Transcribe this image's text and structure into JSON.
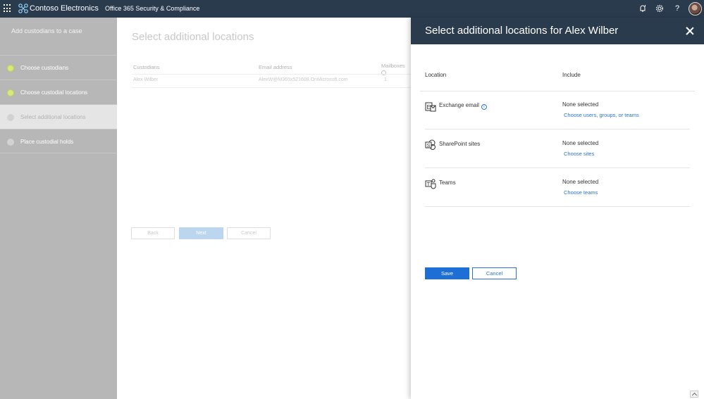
{
  "topbar": {
    "brand": "Contoso Electronics",
    "app": "Office 365 Security & Compliance",
    "icons": [
      "waffle-icon",
      "bell-icon",
      "gear-icon",
      "help-icon",
      "avatar"
    ]
  },
  "leftnav": {
    "title": "Add custodians to a case",
    "steps": [
      {
        "label": "Choose custodians",
        "state": "done"
      },
      {
        "label": "Choose custodial locations",
        "state": "done"
      },
      {
        "label": "Select additional locations",
        "state": "current"
      },
      {
        "label": "Place custodial holds",
        "state": "pending"
      }
    ]
  },
  "main": {
    "title": "Select additional locations",
    "columns": [
      "Custodians",
      "Email address",
      "Mailboxes"
    ],
    "rows": [
      {
        "custodian": "Alex Wilber",
        "email": "AlexW@M365x521608.OnMicrosoft.com",
        "mailboxes": "1"
      }
    ],
    "buttons": {
      "back": "Back",
      "next": "Next",
      "cancel": "Cancel"
    }
  },
  "panel": {
    "title": "Select additional locations for Alex Wilber",
    "col_location": "Location",
    "col_include": "Include",
    "locations": [
      {
        "name": "Exchange email",
        "icon": "exchange-icon",
        "status": "None selected",
        "link": "Choose users, groups, or teams",
        "info": "i"
      },
      {
        "name": "SharePoint sites",
        "icon": "sharepoint-icon",
        "status": "None selected",
        "link": "Choose sites"
      },
      {
        "name": "Teams",
        "icon": "teams-icon",
        "status": "None selected",
        "link": "Choose teams"
      }
    ],
    "save": "Save",
    "cancel": "Cancel"
  },
  "colors": {
    "topbar": "#2b3b4e",
    "accent": "#1d6fd6",
    "link": "#2e73c8",
    "step_done": "#d7e87c"
  }
}
